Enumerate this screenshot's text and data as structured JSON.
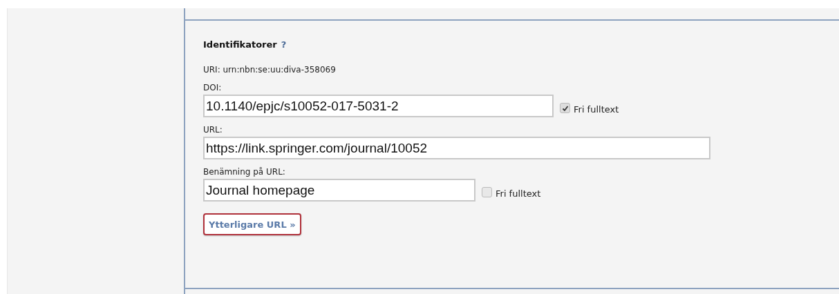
{
  "section": {
    "title": "Identifikatorer",
    "help": "?",
    "uri": "URI: urn:nbn:se:uu:diva-358069",
    "fields": [
      {
        "label": "DOI:",
        "value": "10.1140/epjc/s10052-017-5031-2",
        "fulltext": {
          "label": "Fri fulltext",
          "checked": true
        }
      },
      {
        "label": "URL:",
        "value": "https://link.springer.com/journal/10052"
      },
      {
        "label": "Benämning på URL:",
        "value": "Journal homepage",
        "fulltext": {
          "label": "Fri fulltext",
          "checked": false
        }
      }
    ],
    "more_button": "Ytterligare URL »"
  }
}
